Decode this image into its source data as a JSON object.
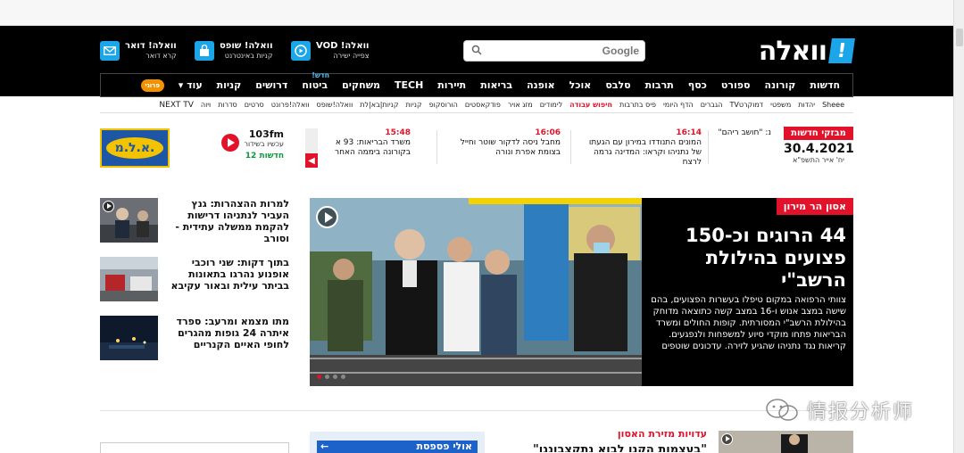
{
  "site": {
    "logo_text": "וואלה",
    "logo_mark": "!",
    "search_brand": "Google",
    "services": [
      {
        "title": "וואלה! VOD",
        "sub": "צפייה ישירה",
        "icon": "play-circle-icon"
      },
      {
        "title": "וואלה! שופס",
        "sub": "קניות באינטרנט",
        "icon": "shopping-bag-icon"
      },
      {
        "title": "וואלה! דואר",
        "sub": "קרא דואר",
        "icon": "mail-icon"
      }
    ]
  },
  "mainnav": {
    "items": [
      "חדשות",
      "קורונה",
      "ספורט",
      "כסף",
      "תרבות",
      "סלבס",
      "אוכל",
      "אופנה",
      "בריאות",
      "תיירות",
      "TECH",
      "משחקים",
      "ביטוח",
      "דרושים",
      "קניות"
    ],
    "new_label": "חדש!",
    "more_label": "עוד ▾",
    "badge_text": "פרוגי"
  },
  "subnav": {
    "items": [
      "Sheee",
      "יהדות",
      "משפטי",
      "דמוקרטTV",
      "הגברים",
      "הדף היומי",
      "פיס בתרבות",
      "חיפוש עבודה",
      "לימודים",
      "מזג אויר",
      "פודקאסטים",
      "הורוסקופ",
      "קניות",
      "קניות|בא|לת",
      "וואלה!שופס",
      "וואלה!פרונט",
      "סרטים",
      "סדרות",
      "ויוה",
      "NEXT TV"
    ],
    "highlight_index": 7
  },
  "ticker": {
    "label": "מבזקי חדשות",
    "date": "30.4.2021",
    "hebrew_date": "יח' אייר התשפ\"א",
    "items": [
      {
        "time": "",
        "text": "נ: \"חושב ריהם\""
      },
      {
        "time": "16:14",
        "text": "המונים התנודדו במירון עם הגעתו של נתניהו וקראו: המדינה גרמה לרצח"
      },
      {
        "time": "16:06",
        "text": "מחבל ניסה לדקור שוטר וחייל בצומת אפרת ונורה"
      },
      {
        "time": "15:48",
        "text": "משרד הבריאות: 93 א בקורונה ביממה האחר"
      }
    ],
    "radio": {
      "freq": "103fm",
      "sub": "עכשיו בשידור",
      "news": "חדשות 12"
    },
    "ad_text": "א.ל.מ."
  },
  "sidebar": {
    "items": [
      {
        "text": "למרות ההצהרות: גנץ העביר לנתניהו דרישות להקמת ממשלה עתידית - וסורב",
        "video": true
      },
      {
        "text": "בתוך דקות: שני רוכבי אופנוע נהרגו בתאונות בביתר עילית ובאור עקיבא",
        "video": false
      },
      {
        "text": "מתו מצמא ומרעב: ספרד איתרה 24 גופות מהגרים לחופי האיים הקנריים",
        "video": false
      }
    ]
  },
  "hero": {
    "category": "אסון הר מירון",
    "headline": "44 הרוגים וכ-150 פצועים בהילולת הרשב\"י",
    "lede": "צוותי הרפואה במקום טיפלו בעשרות הפצועים, בהם שישה במצב אנוש ו-16 במצב קשה כתוצאה מדוחק בהילולת הרשב\"י המסורתית. קופות החולים ומשרד הבריאות פתחו מוקדי סיוע למשפחות ולנפגעים. קריאות נגד נתניהו שהגיע לזירה. עדכונים שוטפים",
    "dots": 4,
    "active_dot": 0
  },
  "bottom": {
    "box_title": "אולי פספסת",
    "mid_category": "עדויות מזירת האסון",
    "mid_headline": "\"בעצמות הקנו לבוא נתקצבוננו\""
  },
  "watermark": {
    "text": "情报分析师"
  },
  "colors": {
    "brand_red": "#e3122b",
    "brand_blue": "#1aa6e8",
    "nav_black": "#000000"
  }
}
